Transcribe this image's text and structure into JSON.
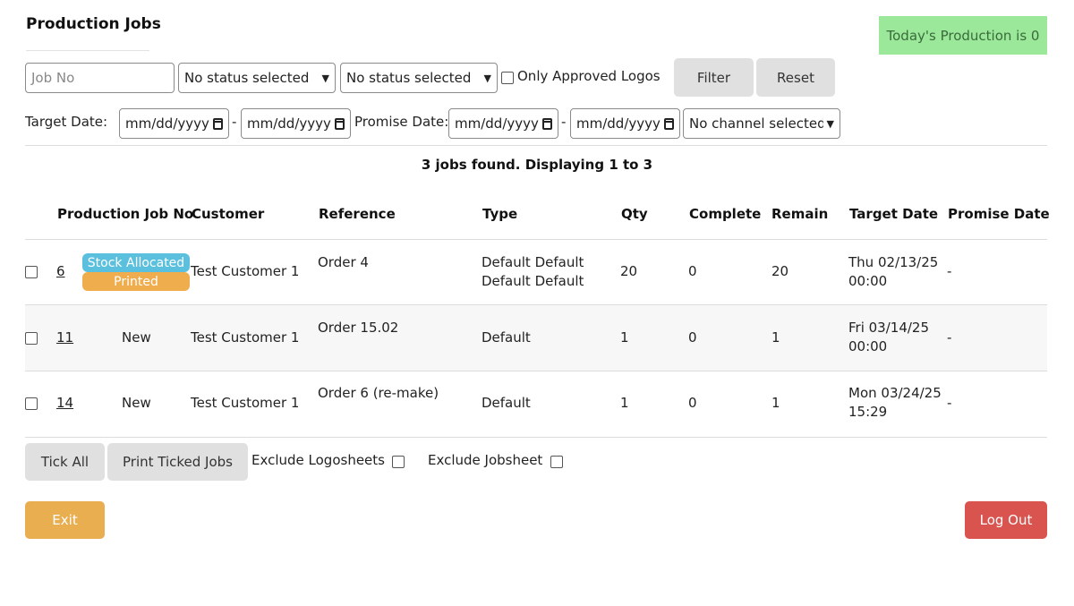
{
  "header": {
    "title": "Production Jobs",
    "production_badge": "Today's Production is 0"
  },
  "filters": {
    "job_no_placeholder": "Job No",
    "status1": "No status selected",
    "status2": "No status selected",
    "approved_logos_label": "Only Approved Logos",
    "filter_label": "Filter",
    "reset_label": "Reset",
    "target_date_label": "Target Date:",
    "date_placeholder": "mm/dd/yyyy",
    "dash": "-",
    "promise_date_label": "Promise Date:",
    "channel": "No channel selected"
  },
  "results": {
    "summary": "3 jobs found. Displaying 1 to 3"
  },
  "table": {
    "headers": {
      "job_no": "Production Job No",
      "customer": "Customer",
      "reference": "Reference",
      "type": "Type",
      "qty": "Qty",
      "complete": "Complete",
      "remain": "Remain",
      "target_date": "Target Date",
      "promise_date": "Promise Date"
    },
    "rows": [
      {
        "job_no": "6",
        "status_badges": [
          "Stock Allocated",
          "Printed"
        ],
        "customer": "Test Customer 1",
        "reference": "Order 4",
        "type_line1": "Default Default",
        "type_line2": "Default Default",
        "qty": "20",
        "complete": "0",
        "remain": "20",
        "target_line1": "Thu 02/13/25",
        "target_line2": "00:00",
        "promise": "-"
      },
      {
        "job_no": "11",
        "status": "New",
        "customer": "Test Customer 1",
        "reference": "Order 15.02",
        "type": "Default",
        "qty": "1",
        "complete": "0",
        "remain": "1",
        "target_line1": "Fri 03/14/25",
        "target_line2": "00:00",
        "promise": "-"
      },
      {
        "job_no": "14",
        "status": "New",
        "customer": "Test Customer 1",
        "reference": "Order 6 (re-make)",
        "type": "Default",
        "qty": "1",
        "complete": "0",
        "remain": "1",
        "target_line1": "Mon 03/24/25",
        "target_line2": "15:29",
        "promise": "-"
      }
    ]
  },
  "actions": {
    "tick_all": "Tick All",
    "print_ticked": "Print Ticked Jobs",
    "exclude_logosheets": "Exclude Logosheets",
    "exclude_jobsheet": "Exclude Jobsheet",
    "exit": "Exit",
    "logout": "Log Out"
  },
  "colors": {
    "production_badge_bg": "#9be89b",
    "stock_allocated_badge": "#5bc0de",
    "printed_badge": "#f0ad4e",
    "exit_button": "#e8ae50",
    "logout_button": "#d9534f"
  }
}
